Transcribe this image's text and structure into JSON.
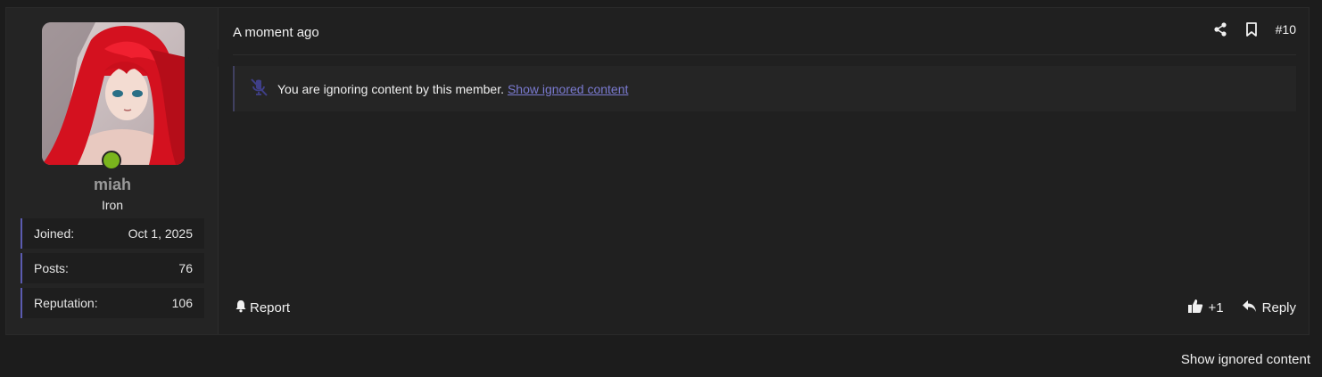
{
  "user": {
    "name": "miah",
    "title": "Iron",
    "stats": [
      {
        "label": "Joined:",
        "value": "Oct 1, 2025"
      },
      {
        "label": "Posts:",
        "value": "76"
      },
      {
        "label": "Reputation:",
        "value": "106"
      }
    ]
  },
  "post": {
    "timestamp": "A moment ago",
    "number": "#10",
    "ignored_message": "You are ignoring content by this member.",
    "show_ignored_link": "Show ignored content"
  },
  "footer": {
    "report_label": "Report",
    "reaction_count": "+1",
    "reply_label": "Reply"
  },
  "page": {
    "show_ignored_label": "Show ignored content"
  }
}
